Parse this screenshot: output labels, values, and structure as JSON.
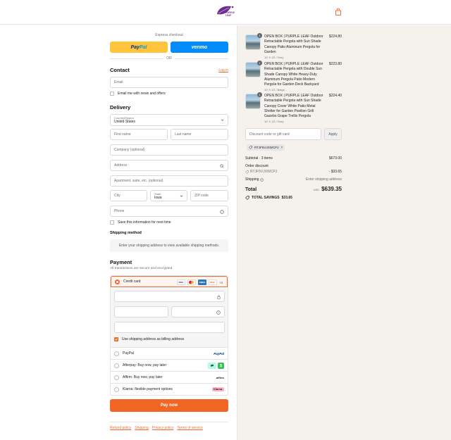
{
  "header": {
    "brand": "PURPLE LEAF"
  },
  "express_checkout": {
    "title": "Express checkout",
    "paypal_label_1": "Pay",
    "paypal_label_2": "Pal",
    "venmo_label": "venmo",
    "or_label": "OR"
  },
  "contact": {
    "title": "Contact",
    "login_label": "Log in",
    "email_placeholder": "Email",
    "news_label": "Email me with news and offers"
  },
  "delivery": {
    "title": "Delivery",
    "country_label": "Country/Region",
    "country_value": "United States",
    "first_name": "First name",
    "last_name": "Last name",
    "company": "Company (optional)",
    "address": "Address",
    "apartment": "Apartment, suite, etc. (optional)",
    "city": "City",
    "state_label": "State",
    "state_value": "Iowa",
    "zip": "ZIP code",
    "phone": "Phone",
    "save_label": "Save this information for next time"
  },
  "shipping_method": {
    "title": "Shipping method",
    "message": "Enter your shipping address to view available shipping methods."
  },
  "payment": {
    "title": "Payment",
    "subtitle": "All transactions are secure and encrypted.",
    "credit_card_label": "Credit card",
    "more_cards": "+3",
    "billing_label": "Use shipping address as billing address",
    "options": [
      {
        "label": "PayPal",
        "logo": "PayPal"
      },
      {
        "label": "Afterpay: Buy now, pay later",
        "logo": "afterpay"
      },
      {
        "label": "Affirm: Buy now, pay later",
        "logo": "affirm"
      },
      {
        "label": "Klarna: flexible payment options",
        "logo": "Klarna."
      }
    ],
    "pay_now": "Pay now"
  },
  "footer": {
    "links": [
      "Refund policy",
      "Shipping",
      "Privacy policy",
      "Terms of service"
    ]
  },
  "order": {
    "items": [
      {
        "title": "OPEN BOX | PURPLE LEAF Outdoor Retractable Pergola with Sun Shade Canopy Patio Aluminum Pergola for Garden",
        "variant": "10' X 13' / Grey",
        "price": "$224.80",
        "qty": "1"
      },
      {
        "title": "OPEN BOX | PURPLE LEAF Outdoor Retractable Pergola with Double Sun Shade Canopy White Heavy-Duty Aluminum Pergola Patio Modern Pergola for Garden Deck Backyard",
        "variant": "10' X 13' / Beige",
        "price": "$223.80",
        "qty": "1"
      },
      {
        "title": "OPEN BOX | PURPLE LEAF Outdoor Retractable Pergola with Sun Shade Canopy Cover White Patio Metal Shelter for Garden Pavilion Grill Gazebo Grape Trellis Pergola",
        "variant": "10' X 13' / Grey",
        "price": "$224.40",
        "qty": "1"
      }
    ],
    "discount_placeholder": "Discount code or gift card",
    "apply_label": "Apply",
    "code": "RTJF5VJXWCPJ",
    "subtotal_label": "Subtotal · 3 items",
    "subtotal_value": "$673.00",
    "order_discount_label": "Order discount",
    "discount_code": "RTJF5VJXWCPJ",
    "discount_value": "- $33.65",
    "shipping_label": "Shipping",
    "shipping_value": "Enter shipping address",
    "total_label": "Total",
    "currency": "USD",
    "total_value": "$639.35",
    "savings_label": "TOTAL SAVINGS",
    "savings_value": "$33.65"
  },
  "colors": {
    "accent": "#f26522",
    "paypal": "#ffc439",
    "venmo": "#008cff",
    "sidebar_bg": "#f5f2ee"
  }
}
